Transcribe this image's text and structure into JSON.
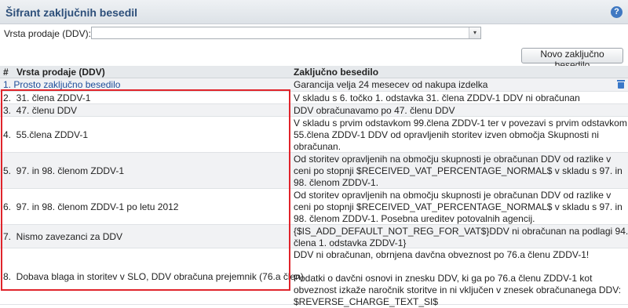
{
  "header": {
    "title": "Šifrant zaključnih besedil",
    "help_label": "?"
  },
  "filter": {
    "label": "Vrsta prodaje (DDV):",
    "value": "",
    "arrow": "▾"
  },
  "toolbar": {
    "new_button": "Novo zaključno besedilo"
  },
  "table": {
    "headers": {
      "index": "#",
      "type": "Vrsta prodaje (DDV)",
      "text": "Zaključno besedilo"
    },
    "rows": [
      {
        "type": "1. Prosto zaključno besedilo",
        "text": [
          "Garancija velja 24 mesecev od nakupa izdelka"
        ]
      },
      {
        "type": "2.  31. člena ZDDV-1",
        "text": [
          "V skladu s 6. točko 1. odstavka 31. člena ZDDV-1 DDV ni obračunan"
        ]
      },
      {
        "type": "3.  47. členu DDV",
        "text": [
          "DDV obračunavamo po 47. členu DDV"
        ]
      },
      {
        "type": "4.  55.člena ZDDV-1",
        "text": [
          "V skladu s prvim odstavkom 99.člena ZDDV-1 ter v povezavi s prvim odstavkom",
          "55.člena ZDDV-1 DDV od opravljenih storitev izven območja Skupnosti ni",
          "obračunan."
        ]
      },
      {
        "type": "5.  97. in 98. členom ZDDV-1",
        "text": [
          "Od storitev opravljenih na območju skupnosti je obračunan DDV od razlike v",
          "ceni po stopnji $RECEIVED_VAT_PERCENTAGE_NORMAL$ v skladu s 97. in",
          "98. členom ZDDV-1."
        ]
      },
      {
        "type": "6.  97. in 98. členom ZDDV-1 po letu 2012",
        "text": [
          "Od storitev opravljenih na območju skupnosti je obračunan DDV od razlike v",
          "ceni po stopnji $RECEIVED_VAT_PERCENTAGE_NORMAL$ v skladu s 97. in",
          "98. členom ZDDV-1. Posebna ureditev potovalnih agencij."
        ]
      },
      {
        "type": "7.  Nismo zavezanci za DDV",
        "text": [
          "{$IS_ADD_DEFAULT_NOT_REG_FOR_VAT$}DDV ni obračunan na podlagi 94.",
          "člena 1. odstavka ZDDV-1}"
        ]
      },
      {
        "type": "8.  Dobava blaga in storitev v SLO, DDV obračuna prejemnik (76.a člen)",
        "text": [
          "DDV ni obračunan, obrnjena davčna obveznost po 76.a členu ZDDV-1!",
          "",
          "Podatki o davčni osnovi in znesku DDV, ki ga po 76.a členu ZDDV-1 kot",
          "obveznost izkaže naročnik storitve in ni vključen v znesek obračunanega DDV:",
          "$REVERSE_CHARGE_TEXT_SI$"
        ]
      }
    ]
  },
  "colors": {
    "highlight": "#e0242b",
    "link": "#1f4e9a",
    "title": "#2d4f7a"
  }
}
